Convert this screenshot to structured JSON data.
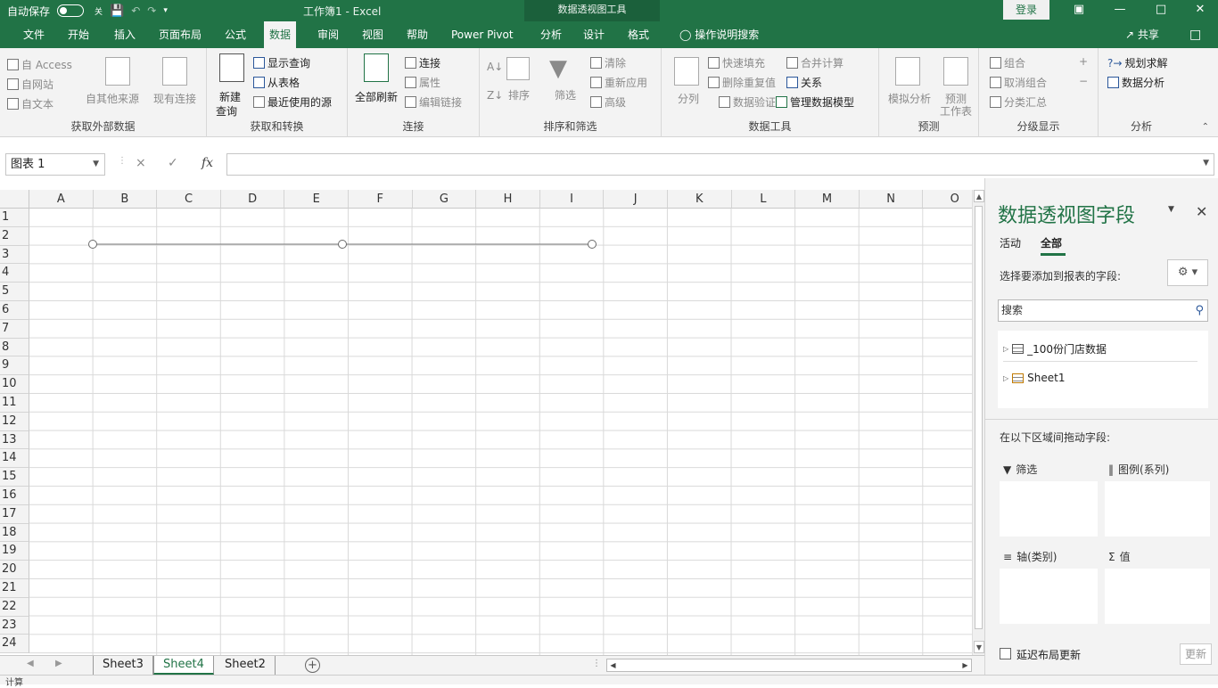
{
  "titlebar": {
    "autosave": "自动保存",
    "autosave_state": "关",
    "doc_title": "工作簿1 - Excel",
    "context_tools": "数据透视图工具",
    "login": "登录"
  },
  "menu": {
    "tabs": [
      "文件",
      "开始",
      "插入",
      "页面布局",
      "公式",
      "数据",
      "审阅",
      "视图",
      "帮助",
      "Power Pivot",
      "分析",
      "设计",
      "格式"
    ],
    "active_tab": "数据",
    "tell_me": "操作说明搜索",
    "share": "共享"
  },
  "ribbon": {
    "get_external": {
      "label": "获取外部数据",
      "access": "自 Access",
      "web": "自网站",
      "text": "自文本",
      "other": "自其他来源",
      "existing": "现有连接"
    },
    "get_transform": {
      "label": "获取和转换",
      "new_query_1": "新建",
      "new_query_2": "查询",
      "show_queries": "显示查询",
      "from_table": "从表格",
      "recent_sources": "最近使用的源"
    },
    "connections": {
      "label": "连接",
      "refresh_all": "全部刷新",
      "connections": "连接",
      "properties": "属性",
      "edit_links": "编辑链接"
    },
    "sort_filter": {
      "label": "排序和筛选",
      "sort": "排序",
      "filter": "筛选",
      "clear": "清除",
      "reapply": "重新应用",
      "advanced": "高级"
    },
    "data_tools": {
      "label": "数据工具",
      "text_to_columns": "分列",
      "flash_fill": "快速填充",
      "remove_dup": "删除重复值",
      "validation": "数据验证",
      "consolidate": "合并计算",
      "relationships": "关系",
      "manage_model": "管理数据模型"
    },
    "forecast": {
      "label": "预测",
      "what_if": "模拟分析",
      "forecast_sheet_1": "预测",
      "forecast_sheet_2": "工作表"
    },
    "outline": {
      "label": "分级显示",
      "group": "组合",
      "ungroup": "取消组合",
      "subtotal": "分类汇总"
    },
    "analysis": {
      "label": "分析",
      "solver": "规划求解",
      "data_analysis": "数据分析"
    }
  },
  "formula": {
    "name_box": "图表 1",
    "cancel": "×",
    "enter": "✓",
    "fx": "fx",
    "value": ""
  },
  "grid": {
    "columns": [
      "A",
      "B",
      "C",
      "D",
      "E",
      "F",
      "G",
      "H",
      "I",
      "J",
      "K",
      "L",
      "M",
      "N",
      "O"
    ],
    "rows": [
      "1",
      "2",
      "3",
      "4",
      "5",
      "6",
      "7",
      "8",
      "9",
      "10",
      "11",
      "12",
      "13",
      "14",
      "15",
      "16",
      "17",
      "18",
      "19",
      "20",
      "21",
      "22",
      "23",
      "24"
    ]
  },
  "sheets": {
    "tabs": [
      "Sheet3",
      "Sheet4",
      "Sheet2"
    ],
    "active": "Sheet4"
  },
  "status": {
    "ready": "计算"
  },
  "pivot": {
    "title": "数据透视图字段",
    "tab_active": "活动",
    "tab_all": "全部",
    "choose_label": "选择要添加到报表的字段:",
    "search_placeholder": "搜索",
    "fields": [
      "_100份门店数据",
      "Sheet1"
    ],
    "drag_label": "在以下区域间拖动字段:",
    "area_filter": "筛选",
    "area_legend": "图例(系列)",
    "area_axis": "轴(类别)",
    "area_values": "值",
    "defer": "延迟布局更新",
    "update": "更新"
  },
  "colors": {
    "brand": "#217346",
    "ribbon_bg": "#f3f3f3"
  }
}
